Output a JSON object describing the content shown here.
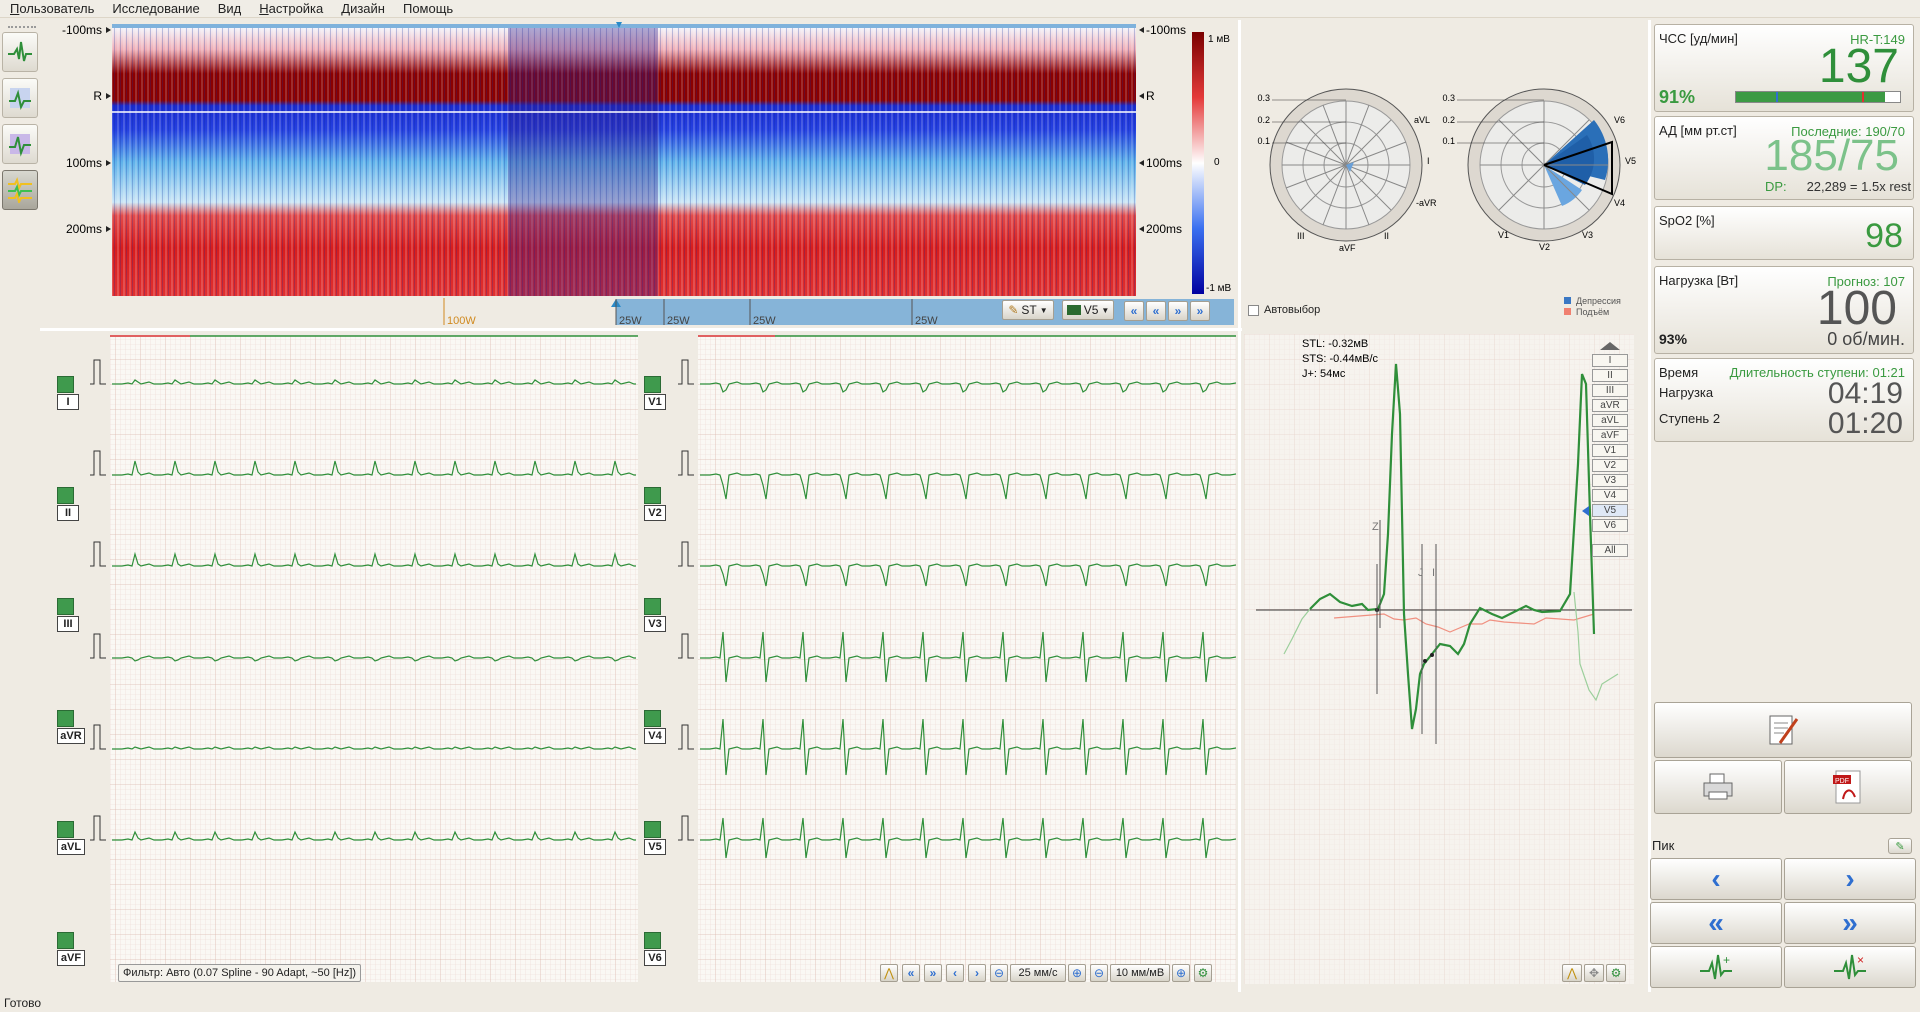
{
  "menu": [
    "Пользователь",
    "Исследование",
    "Вид",
    "Настройка",
    "Дизайн",
    "Помощь"
  ],
  "status": "Готово",
  "trend": {
    "ylabels": [
      "-100ms",
      "R",
      "100ms",
      "200ms"
    ],
    "ylabels_right": [
      "-100ms",
      "R",
      "100ms",
      "200ms"
    ],
    "colorbar": [
      "1 мВ",
      "0",
      "-1 мВ"
    ],
    "markers": [
      "100W",
      "25W",
      "25W",
      "25W",
      "25W"
    ],
    "st_select": "ST",
    "lead_select": "V5"
  },
  "polar": {
    "left_ticks": [
      "0.3",
      "0.2",
      "0.1"
    ],
    "left_labels": [
      "aVL",
      "I",
      "-aVR",
      "II",
      "aVF",
      "III"
    ],
    "right_ticks": [
      "0.3",
      "0.2",
      "0.1"
    ],
    "right_labels": [
      "V6",
      "V5",
      "V4",
      "V3",
      "V2",
      "V1"
    ],
    "autoselect": "Автовыбор",
    "legend": [
      "Депрессия",
      "Подъём"
    ]
  },
  "ecg": {
    "left_leads": [
      "I",
      "II",
      "III",
      "aVR",
      "aVL",
      "aVF"
    ],
    "right_leads": [
      "V1",
      "V2",
      "V3",
      "V4",
      "V5",
      "V6"
    ],
    "filter": "Фильтр: Авто (0.07 Spline - 90 Adapt, ~50 [Hz])",
    "speed": "25 мм/с",
    "gain": "10 мм/мВ"
  },
  "complex": {
    "stl": "STL: -0.32мВ",
    "sts": "STS: -0.44мВ/с",
    "jplus": "J+: 54мс",
    "markers": [
      "Z",
      "J",
      "I"
    ],
    "leads": [
      "I",
      "II",
      "III",
      "aVR",
      "aVL",
      "aVF",
      "V1",
      "V2",
      "V3",
      "V4",
      "V5",
      "V6",
      "All"
    ]
  },
  "vitals": {
    "hr": {
      "label": "ЧСС [уд/мин]",
      "sub": "HR-T:149",
      "value": "137",
      "percent": "91%",
      "fill_fraction": 0.91
    },
    "bp": {
      "label": "АД [мм рт.ст]",
      "last": "Последние: 190/70",
      "value": "185/75",
      "dp_label": "DP:",
      "dp": "22,289 = 1.5x rest"
    },
    "spo2": {
      "label": "SpO2 [%]",
      "value": "98"
    },
    "load": {
      "label": "Нагрузка [Вт]",
      "forecast": "Прогноз: 107",
      "value": "100",
      "percent": "93%",
      "rpm": "0 об/мин."
    },
    "time": {
      "label": "Время",
      "stage_dur": "Длительность ступени: 01:21",
      "load_label": "Нагрузка",
      "stage_label": "Ступень 2",
      "time_value": "04:19",
      "stage_value": "01:20"
    }
  },
  "peak": {
    "label": "Пик"
  },
  "colors": {
    "ecg_green": "#2f8f3a",
    "accent_blue": "#2f6fd0",
    "red": "#c0141c",
    "depression": "#3b78c4",
    "elevation": "#f08070"
  }
}
